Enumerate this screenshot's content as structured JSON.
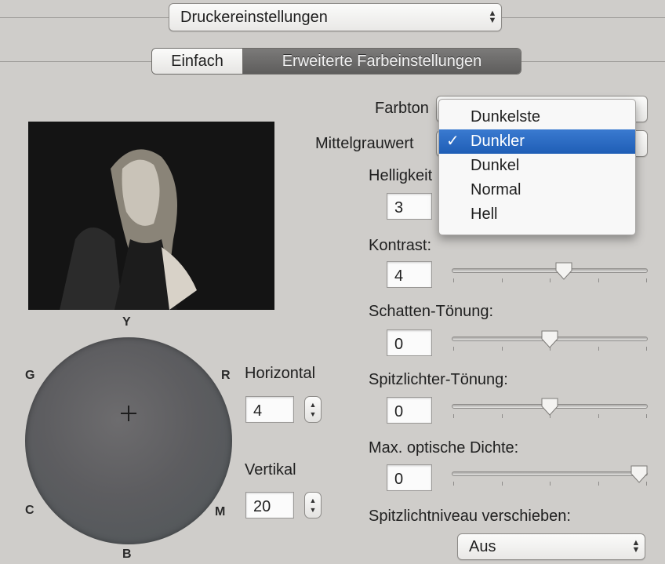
{
  "top_popup": {
    "value": "Druckereinstellungen"
  },
  "tabs": [
    "Einfach",
    "Erweiterte Farbeinstellungen"
  ],
  "farbton": {
    "label": "Farbton"
  },
  "mittelgrauwert": {
    "label": "Mittelgrauwert"
  },
  "helligkeit": {
    "label": "Helligkeit",
    "value": "3"
  },
  "dropdown": {
    "options": [
      "Dunkelste",
      "Dunkler",
      "Dunkel",
      "Normal",
      "Hell"
    ],
    "selected": "Dunkler",
    "check": "✓"
  },
  "kontrast": {
    "label": "Kontrast:",
    "value": "4"
  },
  "schatten": {
    "label": "Schatten-Tönung:",
    "value": "0"
  },
  "spitzlichter": {
    "label": "Spitzlichter-Tönung:",
    "value": "0"
  },
  "dichte": {
    "label": "Max. optische Dichte:",
    "value": "0"
  },
  "spitzlichtniveau": {
    "label": "Spitzlichtniveau verschieben:",
    "value": "Aus"
  },
  "wheel": {
    "Y": "Y",
    "G": "G",
    "R": "R",
    "C": "C",
    "M": "M",
    "B": "B"
  },
  "horizontal": {
    "label": "Horizontal",
    "value": "4"
  },
  "vertikal": {
    "label": "Vertikal",
    "value": "20"
  },
  "colors": {
    "background": "#cfcdca",
    "tab_active": "#6b6a69",
    "menu_highlight": "#2a6cc6"
  }
}
